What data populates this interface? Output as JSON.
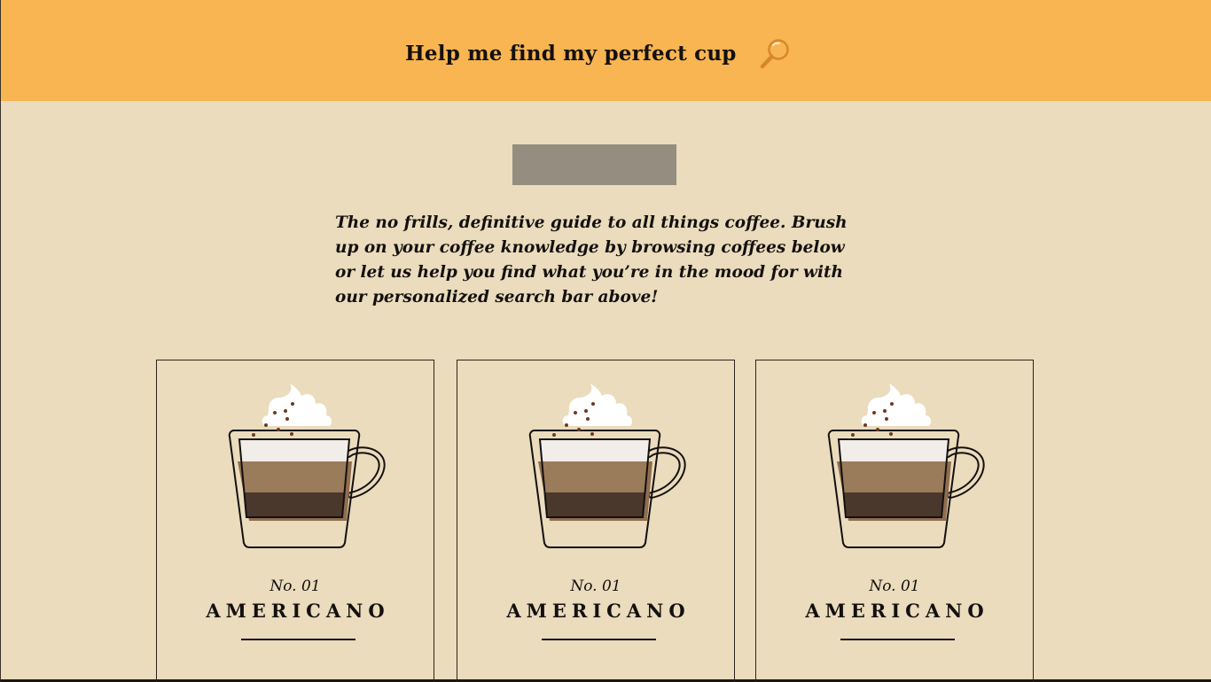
{
  "header": {
    "search_prompt": "Help me find my perfect cup",
    "search_icon": "magnifying-glass-icon",
    "background_color": "#f8b551"
  },
  "intro": {
    "text": "The no frills, definitive guide to all things coffee. Brush up on your coffee knowledge by browsing coffees below or let us help you find what you’re in the mood for with our personalized search bar above!"
  },
  "coffees": [
    {
      "number": "No. 01",
      "name": "AMERICANO",
      "icon": "coffee-cup-with-whipped-cream-icon"
    },
    {
      "number": "No. 01",
      "name": "AMERICANO",
      "icon": "coffee-cup-with-whipped-cream-icon"
    },
    {
      "number": "No. 01",
      "name": "AMERICANO",
      "icon": "coffee-cup-with-whipped-cream-icon"
    }
  ],
  "colors": {
    "page_background": "#eadcbc",
    "logo_placeholder": "#958d80",
    "text": "#141010"
  }
}
